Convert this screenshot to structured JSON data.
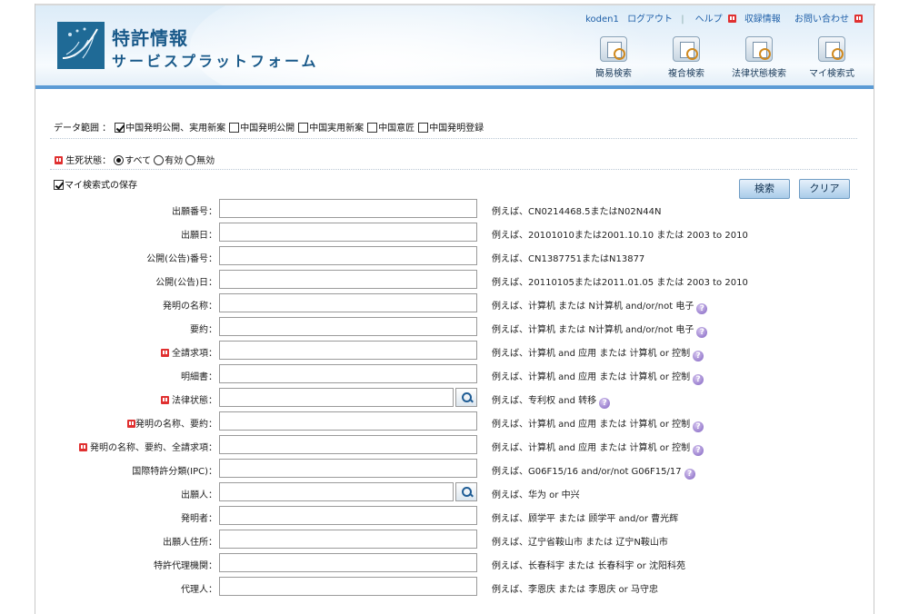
{
  "header": {
    "title": "特許情報",
    "subtitle": "サービスプラットフォーム",
    "links": {
      "user": "koden1",
      "logout": "ログアウト",
      "help": "ヘルプ",
      "collection": "収録情報",
      "contact": "お問い合わせ"
    },
    "nav": [
      {
        "label": "簡易検索",
        "icon": "simple-search-icon"
      },
      {
        "label": "複合検索",
        "icon": "combined-search-icon"
      },
      {
        "label": "法律状態検索",
        "icon": "legal-status-search-icon"
      },
      {
        "label": "マイ検索式",
        "icon": "my-search-icon"
      }
    ]
  },
  "data_range": {
    "label": "データ範囲 ：",
    "options": [
      {
        "label": "中国発明公開、実用新案",
        "checked": true
      },
      {
        "label": "中国発明公開",
        "checked": false
      },
      {
        "label": "中国実用新案",
        "checked": false
      },
      {
        "label": "中国意匠",
        "checked": false
      },
      {
        "label": "中国発明登録",
        "checked": false
      }
    ]
  },
  "status": {
    "label": "生死状態：",
    "options": [
      {
        "label": "すべて",
        "checked": true
      },
      {
        "label": "有効",
        "checked": false
      },
      {
        "label": "無効",
        "checked": false
      }
    ]
  },
  "save": {
    "label": "マイ検索式の保存",
    "checked": true
  },
  "buttons": {
    "search": "検索",
    "clear": "クリア"
  },
  "fields": [
    {
      "label": "出願番号：",
      "example": "例えば、CN0214468.5またはN02N44N",
      "badge": false,
      "lookup": false,
      "help": false
    },
    {
      "label": "出願日：",
      "example": "例えば、20101010または2001.10.10 または 2003 to 2010",
      "badge": false,
      "lookup": false,
      "help": false
    },
    {
      "label": "公開(公告)番号：",
      "example": "例えば、CN1387751またはN13877",
      "badge": false,
      "lookup": false,
      "help": false
    },
    {
      "label": "公開(公告)日：",
      "example": "例えば、20110105または2011.01.05 または 2003 to 2010",
      "badge": false,
      "lookup": false,
      "help": false
    },
    {
      "label": "発明の名称：",
      "example": "例えば、计算机 または N计算机 and/or/not 电子",
      "badge": false,
      "lookup": false,
      "help": true
    },
    {
      "label": "要約：",
      "example": "例えば、计算机 または N计算机 and/or/not 电子",
      "badge": false,
      "lookup": false,
      "help": true
    },
    {
      "label": "全請求項：",
      "example": "例えば、计算机 and 应用 または 计算机 or 控制",
      "badge": true,
      "lookup": false,
      "help": true
    },
    {
      "label": "明細書：",
      "example": "例えば、计算机 and 应用 または 计算机 or 控制",
      "badge": false,
      "lookup": false,
      "help": true
    },
    {
      "label": "法律状態：",
      "example": "例えば、专利权 and 转移",
      "badge": true,
      "lookup": true,
      "help": true
    },
    {
      "label": "発明の名称、要約：",
      "example": "例えば、计算机 and 应用 または 计算机 or 控制",
      "badge": true,
      "lookup": false,
      "help": true
    },
    {
      "label": "発明の名称、要約、全請求項：",
      "example": "例えば、计算机 and 应用 または 计算机 or 控制",
      "badge": true,
      "lookup": false,
      "help": true
    },
    {
      "label": "国際特許分類(IPC)：",
      "example": "例えば、G06F15/16 and/or/not G06F15/17",
      "badge": false,
      "lookup": false,
      "help": true
    },
    {
      "label": "出願人：",
      "example": "例えば、华为 or 中兴",
      "badge": false,
      "lookup": true,
      "help": false
    },
    {
      "label": "発明者：",
      "example": "例えば、顾学平 または 顾学平 and/or 曹光辉",
      "badge": false,
      "lookup": false,
      "help": false
    },
    {
      "label": "出願人住所：",
      "example": "例えば、辽宁省鞍山市 または 辽宁N鞍山市",
      "badge": false,
      "lookup": false,
      "help": false
    },
    {
      "label": "特許代理機関：",
      "example": "例えば、长春科宇 または 长春科宇 or 沈阳科苑",
      "badge": false,
      "lookup": false,
      "help": false
    },
    {
      "label": "代理人：",
      "example": "例えば、李恩庆 または 李恩庆 or 马守忠",
      "badge": false,
      "lookup": false,
      "help": false
    }
  ]
}
